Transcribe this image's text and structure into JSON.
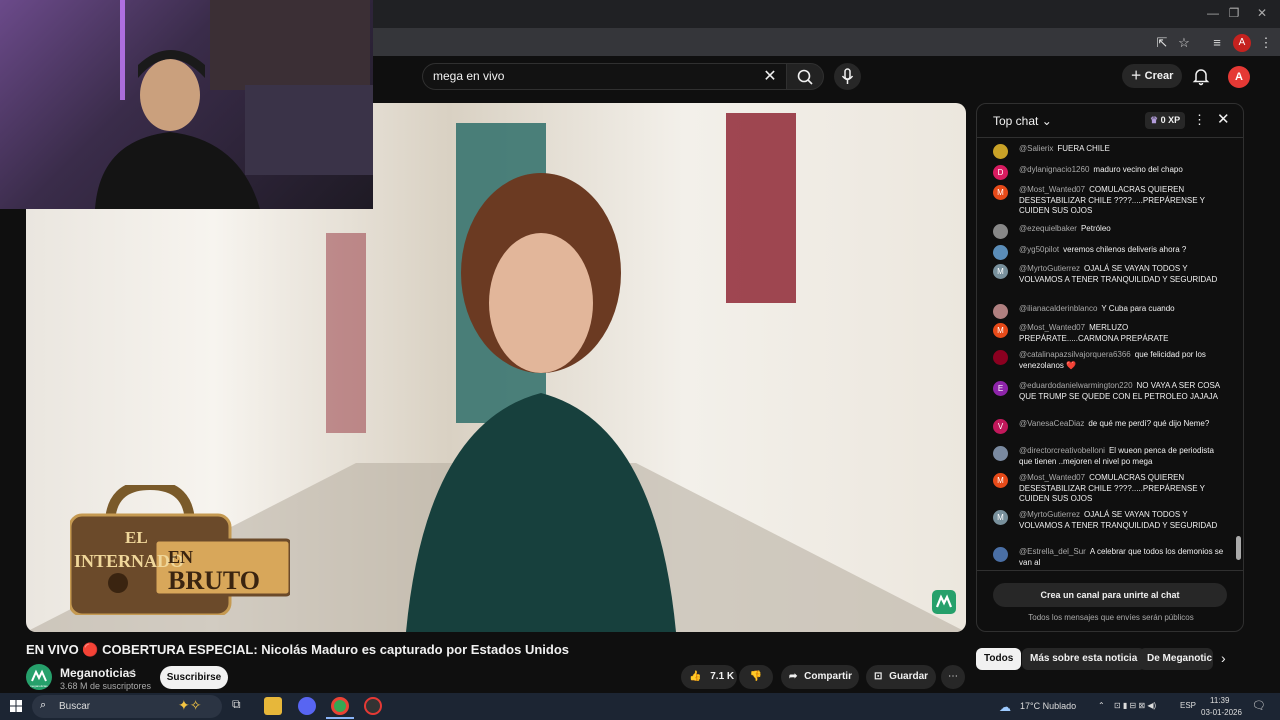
{
  "browser": {
    "window_controls": [
      "—",
      "❐",
      "✕"
    ],
    "profile_initial": "A"
  },
  "header": {
    "search_value": "mega en vivo",
    "create_label": "Crear",
    "avatar_initial": "A"
  },
  "video": {
    "title": "EN VIVO 🔴 COBERTURA ESPECIAL: Nicolás Maduro es capturado por Estados Unidos",
    "show_logo_line1": "EL",
    "show_logo_line2": "INTERNADO",
    "show_logo_line3": "EN",
    "show_logo_line4": "BRUTO"
  },
  "channel": {
    "name": "Meganoticias",
    "avatar_label": "meganoticias",
    "subscribers": "3.68 M de suscriptores",
    "subscribe_label": "Suscribirse"
  },
  "actions": {
    "likes": "7.1 K",
    "share_label": "Compartir",
    "save_label": "Guardar"
  },
  "chat": {
    "title": "Top chat",
    "xp_label": "0 XP",
    "join_label": "Crea un canal para unirte al chat",
    "note": "Todos los mensajes que envíes serán públicos",
    "messages": [
      {
        "author": "@Salierix",
        "text": "FUERA CHILE",
        "initial": "",
        "color": "#c9a227"
      },
      {
        "author": "@dylanignacio1260",
        "text": "maduro vecino del chapo",
        "initial": "D",
        "color": "#d81b60"
      },
      {
        "author": "@Most_Wanted07",
        "text": "COMULACRAS QUIEREN DESESTABILIZAR CHILE ????.....PREPÁRENSE Y CUIDEN SUS OJOS",
        "initial": "M",
        "color": "#e64a19"
      },
      {
        "author": "@ezequielbaker",
        "text": "Petróleo",
        "initial": "",
        "color": "#888888"
      },
      {
        "author": "@yg50pilot",
        "text": "veremos chilenos deliveris ahora ?",
        "initial": "",
        "color": "#5b8db8"
      },
      {
        "author": "@MyrtoGutierrez",
        "text": "OJALÁ SE VAYAN TODOS Y VOLVAMOS A TENER TRANQUILIDAD Y SEGURIDAD",
        "initial": "M",
        "color": "#78909c"
      },
      {
        "author": "@ilianacalderinblanco",
        "text": "Y Cuba para cuando",
        "initial": "",
        "color": "#b08080"
      },
      {
        "author": "@Most_Wanted07",
        "text": "MERLUZO PREPÁRATE.....CARMONA PREPÁRATE",
        "initial": "M",
        "color": "#e64a19"
      },
      {
        "author": "@catalinapazsilvajorquera6366",
        "text": "que felicidad por los venezolanos ❤️",
        "initial": "",
        "color": "#8b0020"
      },
      {
        "author": "@eduardodanielwarmington220",
        "text": "NO VAYA A SER COSA QUE TRUMP SE QUEDE CON EL PETROLEO JAJAJA",
        "initial": "E",
        "color": "#8e24aa"
      },
      {
        "author": "@VanesaCeaDiaz",
        "text": "de qué me perdí? qué dijo Neme?",
        "initial": "V",
        "color": "#c2185b"
      },
      {
        "author": "@directorcreativobelloni",
        "text": "El wueon penca de periodista que tienen ..mejoren el nivel po mega",
        "initial": "",
        "color": "#7a8aa0"
      },
      {
        "author": "@Most_Wanted07",
        "text": "COMULACRAS QUIEREN DESESTABILIZAR CHILE ????.....PREPÁRENSE Y CUIDEN SUS OJOS",
        "initial": "M",
        "color": "#e64a19"
      },
      {
        "author": "@MyrtoGutierrez",
        "text": "OJALÁ SE VAYAN TODOS Y VOLVAMOS A TENER TRANQUILIDAD Y SEGURIDAD",
        "initial": "M",
        "color": "#78909c"
      },
      {
        "author": "@Estrella_del_Sur",
        "text": "A celebrar que todos los demonios se van al",
        "initial": "",
        "color": "#4a6fa5"
      }
    ]
  },
  "chips": [
    "Todos",
    "Más sobre esta noticia",
    "De Meganotic"
  ],
  "taskbar": {
    "search_placeholder": "Buscar",
    "weather": "17°C  Nublado",
    "lang": "ESP",
    "time": "11:39",
    "date": "03-01-2026"
  }
}
